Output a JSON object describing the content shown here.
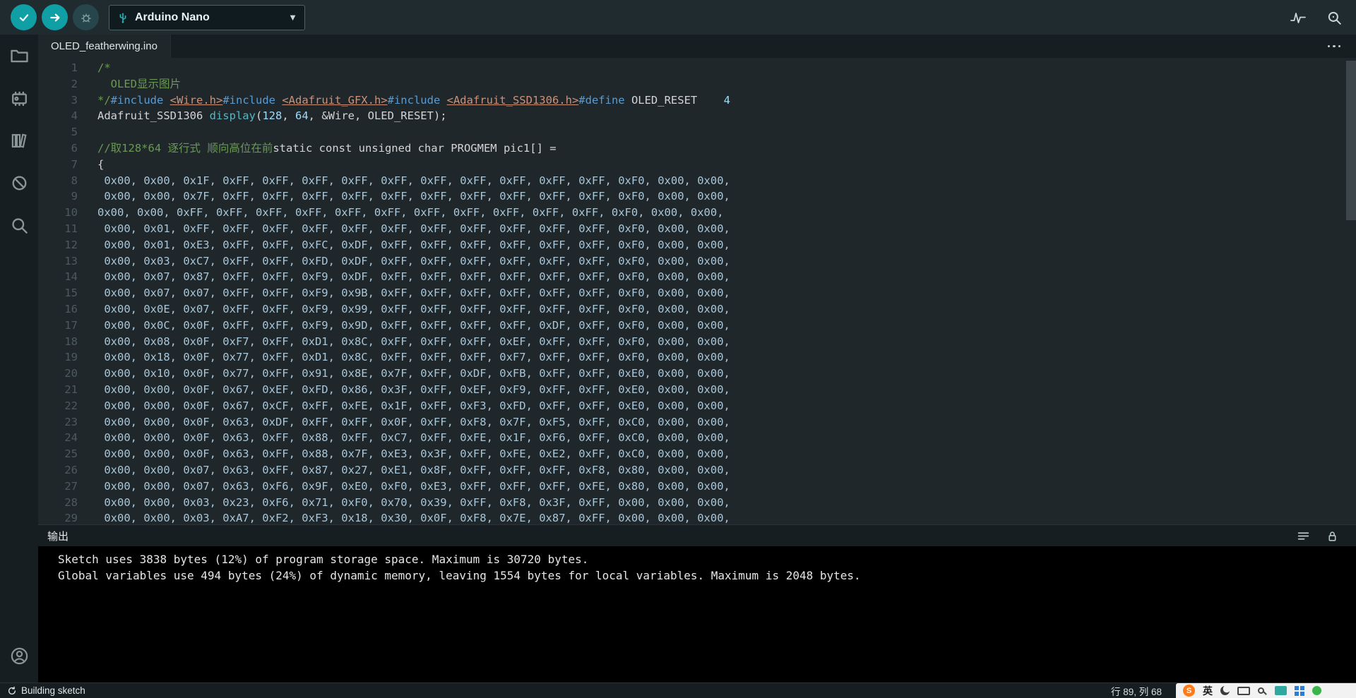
{
  "toolbar": {
    "board_label": "Arduino Nano",
    "icons": [
      "verify-icon",
      "upload-icon",
      "debug-icon",
      "usb-icon",
      "chevron-down-icon",
      "serial-plotter-icon",
      "serial-monitor-icon"
    ]
  },
  "tabbar": {
    "tabs": [
      {
        "label": "OLED_featherwing.ino",
        "active": true
      }
    ],
    "more_actions": "more-actions-icon"
  },
  "sidebar": {
    "icons": [
      "sketchbook-folder-icon",
      "boards-manager-icon",
      "library-manager-icon",
      "debug-icon",
      "search-icon",
      "account-icon"
    ]
  },
  "editor": {
    "lines": [
      {
        "n": "1",
        "s": [
          [
            "c",
            "/*"
          ]
        ]
      },
      {
        "n": "2",
        "s": [
          [
            "c",
            "  OLED显示图片"
          ]
        ]
      },
      {
        "n": "3",
        "s": [
          [
            "c",
            "*/"
          ],
          [
            "k",
            "#include"
          ],
          [
            "d",
            " "
          ],
          [
            "l",
            "<Wire.h>"
          ],
          [
            "k",
            "#include"
          ],
          [
            "d",
            " "
          ],
          [
            "l",
            "<Adafruit_GFX.h>"
          ],
          [
            "k",
            "#include"
          ],
          [
            "d",
            " "
          ],
          [
            "l",
            "<Adafruit_SSD1306.h>"
          ],
          [
            "k",
            "#define"
          ],
          [
            "d",
            " OLED_RESET    "
          ],
          [
            "n",
            "4"
          ]
        ]
      },
      {
        "n": "4",
        "s": [
          [
            "d",
            "Adafruit_SSD1306 "
          ],
          [
            "f",
            "display"
          ],
          [
            "d",
            "("
          ],
          [
            "n",
            "128"
          ],
          [
            "d",
            ", "
          ],
          [
            "n",
            "64"
          ],
          [
            "d",
            ", &Wire, OLED_RESET);"
          ]
        ]
      },
      {
        "n": "5",
        "s": []
      },
      {
        "n": "6",
        "s": [
          [
            "c",
            "//取128*64 逐行式 顺向高位在前"
          ],
          [
            "d",
            "static const unsigned char PROGMEM pic1[] ="
          ]
        ]
      },
      {
        "n": "7",
        "s": [
          [
            "d",
            "{"
          ]
        ]
      },
      {
        "n": "8",
        "s": [
          [
            "h",
            " 0x00, 0x00, 0x1F, 0xFF, 0xFF, 0xFF, 0xFF, 0xFF, 0xFF, 0xFF, 0xFF, 0xFF, 0xFF, 0xF0, 0x00, 0x00,"
          ]
        ]
      },
      {
        "n": "9",
        "s": [
          [
            "h",
            " 0x00, 0x00, 0x7F, 0xFF, 0xFF, 0xFF, 0xFF, 0xFF, 0xFF, 0xFF, 0xFF, 0xFF, 0xFF, 0xF0, 0x00, 0x00,"
          ]
        ]
      },
      {
        "n": "10",
        "s": [
          [
            "h",
            "0x00, 0x00, 0xFF, 0xFF, 0xFF, 0xFF, 0xFF, 0xFF, 0xFF, 0xFF, 0xFF, 0xFF, 0xFF, 0xF0, 0x00, 0x00,"
          ]
        ]
      },
      {
        "n": "11",
        "s": [
          [
            "h",
            " 0x00, 0x01, 0xFF, 0xFF, 0xFF, 0xFF, 0xFF, 0xFF, 0xFF, 0xFF, 0xFF, 0xFF, 0xFF, 0xF0, 0x00, 0x00,"
          ]
        ]
      },
      {
        "n": "12",
        "s": [
          [
            "h",
            " 0x00, 0x01, 0xE3, 0xFF, 0xFF, 0xFC, 0xDF, 0xFF, 0xFF, 0xFF, 0xFF, 0xFF, 0xFF, 0xF0, 0x00, 0x00,"
          ]
        ]
      },
      {
        "n": "13",
        "s": [
          [
            "h",
            " 0x00, 0x03, 0xC7, 0xFF, 0xFF, 0xFD, 0xDF, 0xFF, 0xFF, 0xFF, 0xFF, 0xFF, 0xFF, 0xF0, 0x00, 0x00,"
          ]
        ]
      },
      {
        "n": "14",
        "s": [
          [
            "h",
            " 0x00, 0x07, 0x87, 0xFF, 0xFF, 0xF9, 0xDF, 0xFF, 0xFF, 0xFF, 0xFF, 0xFF, 0xFF, 0xF0, 0x00, 0x00,"
          ]
        ]
      },
      {
        "n": "15",
        "s": [
          [
            "h",
            " 0x00, 0x07, 0x07, 0xFF, 0xFF, 0xF9, 0x9B, 0xFF, 0xFF, 0xFF, 0xFF, 0xFF, 0xFF, 0xF0, 0x00, 0x00,"
          ]
        ]
      },
      {
        "n": "16",
        "s": [
          [
            "h",
            " 0x00, 0x0E, 0x07, 0xFF, 0xFF, 0xF9, 0x99, 0xFF, 0xFF, 0xFF, 0xFF, 0xFF, 0xFF, 0xF0, 0x00, 0x00,"
          ]
        ]
      },
      {
        "n": "17",
        "s": [
          [
            "h",
            " 0x00, 0x0C, 0x0F, 0xFF, 0xFF, 0xF9, 0x9D, 0xFF, 0xFF, 0xFF, 0xFF, 0xDF, 0xFF, 0xF0, 0x00, 0x00,"
          ]
        ]
      },
      {
        "n": "18",
        "s": [
          [
            "h",
            " 0x00, 0x08, 0x0F, 0xF7, 0xFF, 0xD1, 0x8C, 0xFF, 0xFF, 0xFF, 0xEF, 0xFF, 0xFF, 0xF0, 0x00, 0x00,"
          ]
        ]
      },
      {
        "n": "19",
        "s": [
          [
            "h",
            " 0x00, 0x18, 0x0F, 0x77, 0xFF, 0xD1, 0x8C, 0xFF, 0xFF, 0xFF, 0xF7, 0xFF, 0xFF, 0xF0, 0x00, 0x00,"
          ]
        ]
      },
      {
        "n": "20",
        "s": [
          [
            "h",
            " 0x00, 0x10, 0x0F, 0x77, 0xFF, 0x91, 0x8E, 0x7F, 0xFF, 0xDF, 0xFB, 0xFF, 0xFF, 0xE0, 0x00, 0x00,"
          ]
        ]
      },
      {
        "n": "21",
        "s": [
          [
            "h",
            " 0x00, 0x00, 0x0F, 0x67, 0xEF, 0xFD, 0x86, 0x3F, 0xFF, 0xEF, 0xF9, 0xFF, 0xFF, 0xE0, 0x00, 0x00,"
          ]
        ]
      },
      {
        "n": "22",
        "s": [
          [
            "h",
            " 0x00, 0x00, 0x0F, 0x67, 0xCF, 0xFF, 0xFE, 0x1F, 0xFF, 0xF3, 0xFD, 0xFF, 0xFF, 0xE0, 0x00, 0x00,"
          ]
        ]
      },
      {
        "n": "23",
        "s": [
          [
            "h",
            " 0x00, 0x00, 0x0F, 0x63, 0xDF, 0xFF, 0xFF, 0x0F, 0xFF, 0xF8, 0x7F, 0xF5, 0xFF, 0xC0, 0x00, 0x00,"
          ]
        ]
      },
      {
        "n": "24",
        "s": [
          [
            "h",
            " 0x00, 0x00, 0x0F, 0x63, 0xFF, 0x88, 0xFF, 0xC7, 0xFF, 0xFE, 0x1F, 0xF6, 0xFF, 0xC0, 0x00, 0x00,"
          ]
        ]
      },
      {
        "n": "25",
        "s": [
          [
            "h",
            " 0x00, 0x00, 0x0F, 0x63, 0xFF, 0x88, 0x7F, 0xE3, 0x3F, 0xFF, 0xFE, 0xE2, 0xFF, 0xC0, 0x00, 0x00,"
          ]
        ]
      },
      {
        "n": "26",
        "s": [
          [
            "h",
            " 0x00, 0x00, 0x07, 0x63, 0xFF, 0x87, 0x27, 0xE1, 0x8F, 0xFF, 0xFF, 0xFF, 0xF8, 0x80, 0x00, 0x00,"
          ]
        ]
      },
      {
        "n": "27",
        "s": [
          [
            "h",
            " 0x00, 0x00, 0x07, 0x63, 0xF6, 0x9F, 0xE0, 0xF0, 0xE3, 0xFF, 0xFF, 0xFF, 0xFE, 0x80, 0x00, 0x00,"
          ]
        ]
      },
      {
        "n": "28",
        "s": [
          [
            "h",
            " 0x00, 0x00, 0x03, 0x23, 0xF6, 0x71, 0xF0, 0x70, 0x39, 0xFF, 0xF8, 0x3F, 0xFF, 0x00, 0x00, 0x00,"
          ]
        ]
      },
      {
        "n": "29",
        "s": [
          [
            "h",
            " 0x00, 0x00, 0x03, 0xA7, 0xF2, 0xF3, 0x18, 0x30, 0x0F, 0xF8, 0x7E, 0x87, 0xFF, 0x00, 0x00, 0x00,"
          ]
        ]
      }
    ]
  },
  "output": {
    "title": "输出",
    "lines": [
      "Sketch uses 3838 bytes (12%) of program storage space. Maximum is 30720 bytes.",
      "Global variables use 494 bytes (24%) of dynamic memory, leaving 1554 bytes for local variables. Maximum is 2048 bytes."
    ]
  },
  "statusbar": {
    "left": "Building sketch",
    "cursor": "行 89, 列 68"
  },
  "ime_bar": {
    "logo": "S",
    "lang": "英"
  },
  "colors": {
    "accent_teal": "#0f9fa5",
    "chrome_bg": "#171e21",
    "toolbar_bg": "#202b30",
    "editor_bg": "#1f272b",
    "console_bg": "#000000",
    "comment": "#6a9955",
    "keyword": "#569cd6",
    "include_link": "#ce9178",
    "number": "#9cdcfe",
    "function": "#56b6c2"
  }
}
